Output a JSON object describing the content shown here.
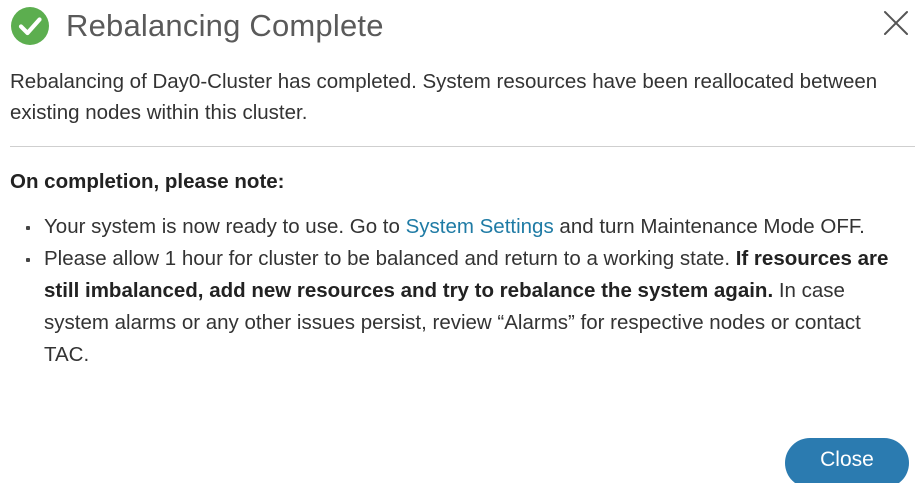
{
  "dialog": {
    "title": "Rebalancing Complete",
    "status_icon": "check-circle-icon",
    "close_icon": "close-icon",
    "summary": "Rebalancing of Day0-Cluster has completed. System resources have been reallocated between existing nodes within this cluster.",
    "note_heading": "On completion, please note:",
    "notes": [
      {
        "before_link": "Your system is now ready to use. Go to ",
        "link": "System Settings",
        "after_link": " and turn Maintenance Mode OFF."
      },
      {
        "text": "Please allow 1 hour for cluster to be balanced and return to a working state. ",
        "bold": "If resources are still imbalanced, add new resources and try to rebalance the system again.",
        "after_bold": " In case system alarms or any other issues persist, review “Alarms” for respective nodes or contact TAC."
      }
    ],
    "close_button_label": "Close"
  },
  "colors": {
    "success_green": "#5cae4f",
    "link_blue": "#1f7ba5",
    "button_blue": "#2b7bb0"
  }
}
